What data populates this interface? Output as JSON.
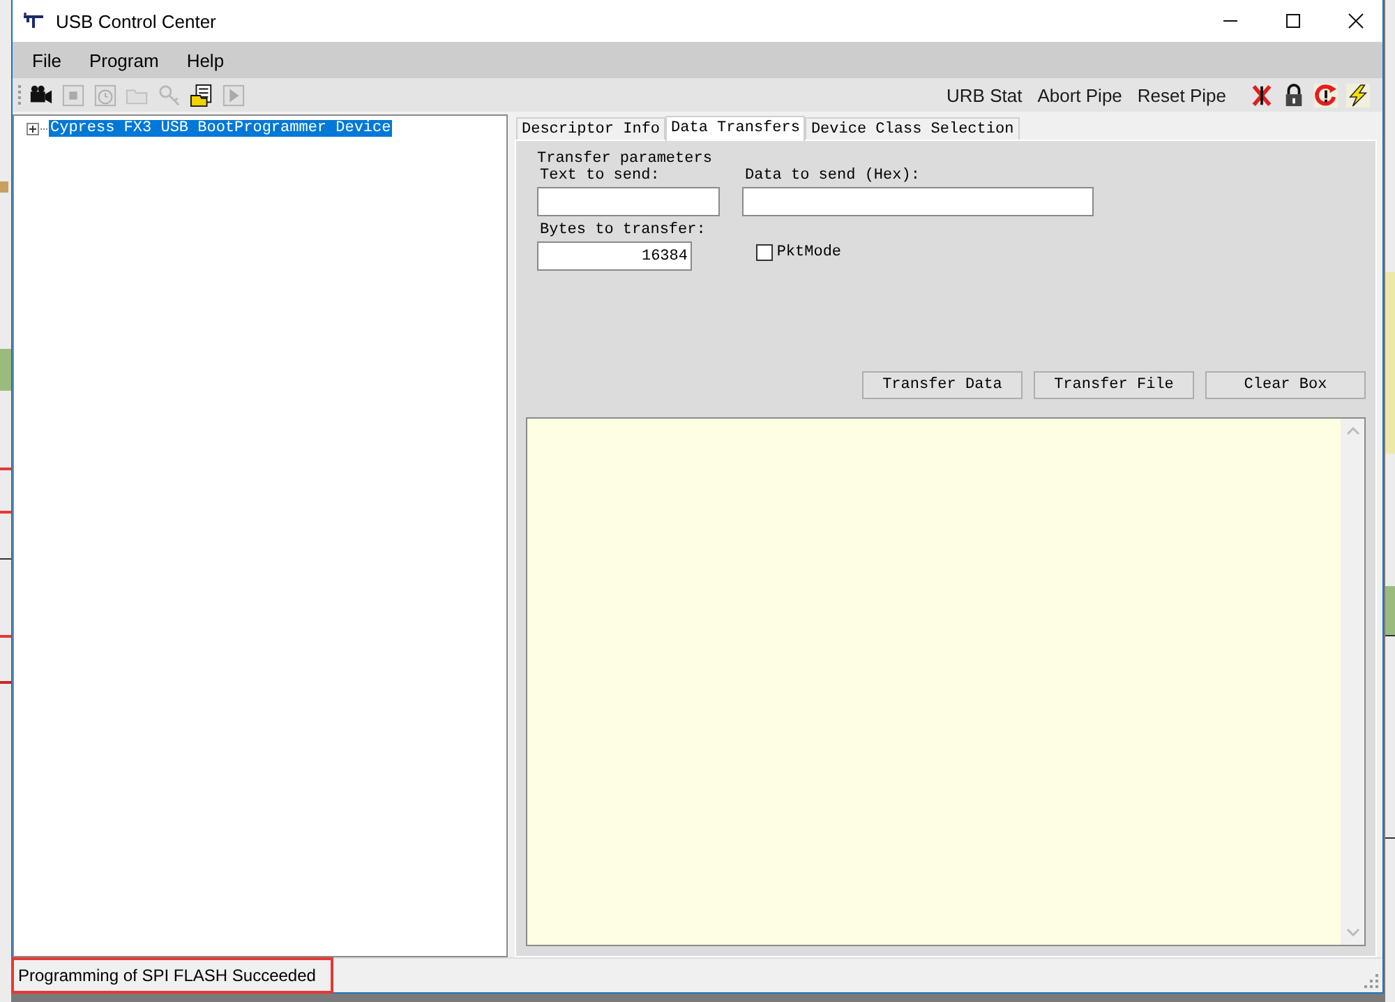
{
  "window": {
    "title": "USB Control Center"
  },
  "menu": [
    "File",
    "Program",
    "Help"
  ],
  "toolbar": {
    "buttons": [
      {
        "kind": "camera",
        "disabled": false
      },
      {
        "kind": "stop",
        "disabled": true
      },
      {
        "kind": "timer",
        "disabled": true
      },
      {
        "kind": "folder",
        "disabled": true
      },
      {
        "kind": "key",
        "disabled": true
      },
      {
        "kind": "document",
        "disabled": false
      },
      {
        "kind": "play",
        "disabled": true
      }
    ],
    "actions": [
      "URB Stat",
      "Abort Pipe",
      "Reset Pipe"
    ],
    "icon_buttons": [
      {
        "kind": "cross"
      },
      {
        "kind": "lock"
      },
      {
        "kind": "reset"
      },
      {
        "kind": "bolt"
      }
    ]
  },
  "tree": [
    {
      "label": "Cypress FX3 USB BootProgrammer Device",
      "expanded": false,
      "selected": true
    }
  ],
  "tabs": [
    {
      "label": "Descriptor Info",
      "selected": false
    },
    {
      "label": "Data Transfers",
      "selected": true
    },
    {
      "label": "Device Class Selection",
      "selected": false
    }
  ],
  "transfer": {
    "group_title": "Transfer parameters",
    "text_label": "Text to send:",
    "hex_label": "Data to send (Hex):",
    "bytes_label": "Bytes to transfer:",
    "bytes_value": "16384",
    "pkt_mode": {
      "label": "PktMode",
      "checked": false
    },
    "buttons": [
      "Transfer Data",
      "Transfer File",
      "Clear Box"
    ]
  },
  "status_bar": {
    "text": "Programming of SPI FLASH Succeeded",
    "highlighted": true
  }
}
